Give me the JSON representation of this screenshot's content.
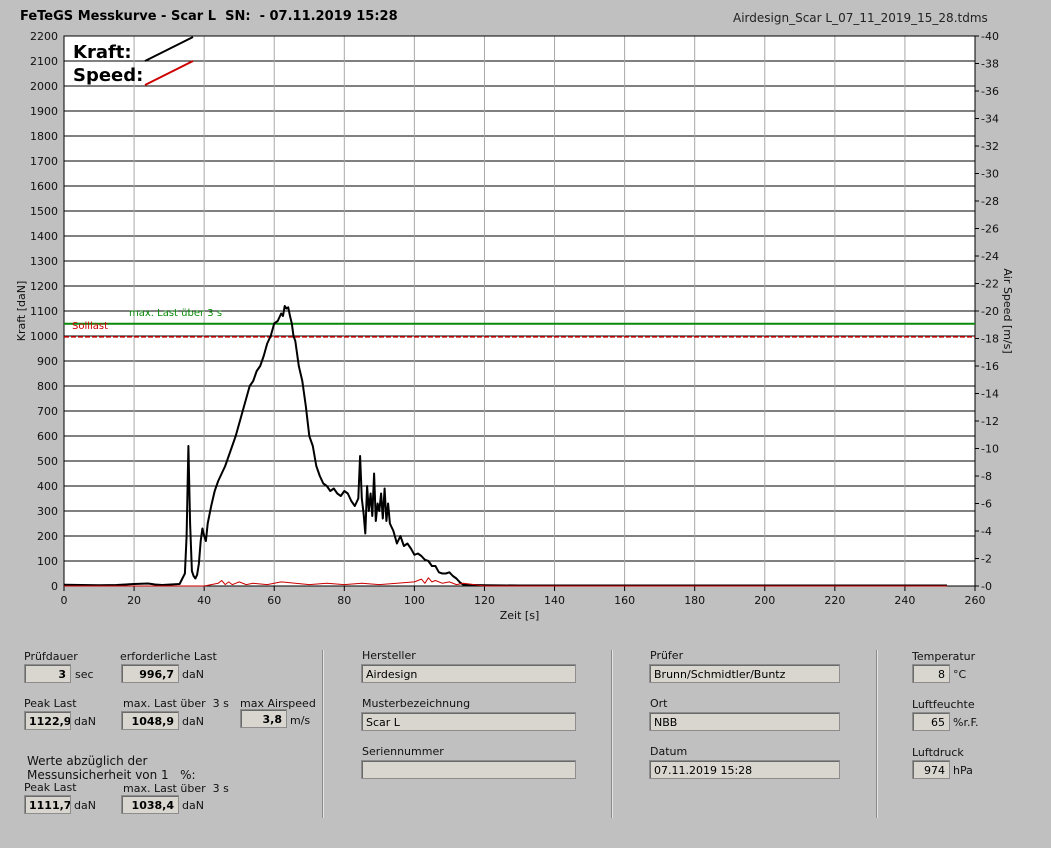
{
  "header": {
    "title": "FeTeGS Messkurve - Scar L  SN:  - 07.11.2019 15:28",
    "filename": "Airdesign_Scar L_07_11_2019_15_28.tdms"
  },
  "chart_data": {
    "type": "line",
    "xlabel": "Zeit [s]",
    "ylabel": "Kraft [daN]",
    "y2label": "Air Speed [m/s]",
    "xlim": [
      0,
      260
    ],
    "ylim": [
      0,
      2200
    ],
    "y2lim": [
      0,
      40
    ],
    "x_ticks": [
      0,
      20,
      40,
      60,
      80,
      100,
      120,
      140,
      160,
      180,
      200,
      220,
      240,
      260
    ],
    "y_ticks": [
      0,
      100,
      200,
      300,
      400,
      500,
      600,
      700,
      800,
      900,
      1000,
      1100,
      1200,
      1300,
      1400,
      1500,
      1600,
      1700,
      1800,
      1900,
      2000,
      2100,
      2200
    ],
    "y2_ticks": [
      0,
      2,
      4,
      6,
      8,
      10,
      12,
      14,
      16,
      18,
      20,
      22,
      24,
      26,
      28,
      30,
      32,
      34,
      36,
      38,
      40
    ],
    "grid": true,
    "legend": {
      "placement": "top-left",
      "items": [
        {
          "label": "Kraft:",
          "color": "#000000"
        },
        {
          "label": "Speed:",
          "color": "#cc0000"
        }
      ]
    },
    "series": [
      {
        "name": "Kraft:",
        "color": "#000000",
        "axis": "left",
        "x": [
          0,
          5,
          10,
          15,
          20,
          24,
          26,
          28,
          33,
          34.5,
          35,
          35.5,
          36,
          36.5,
          37,
          37.5,
          38,
          38.5,
          39,
          39.5,
          40,
          40.5,
          41,
          42,
          43,
          44,
          45,
          46,
          47,
          48,
          49,
          50,
          51,
          52,
          53,
          54,
          55,
          56,
          57,
          58,
          59,
          60,
          61,
          62,
          62.5,
          63,
          63.5,
          64,
          64.5,
          65,
          65.5,
          66,
          67,
          68,
          69,
          70,
          71,
          72,
          73,
          74,
          75,
          76,
          77,
          78,
          79,
          80,
          81,
          82,
          83,
          84,
          84.5,
          85,
          85.5,
          86,
          86.5,
          87,
          87.5,
          88,
          88.5,
          89,
          89.5,
          90,
          90.5,
          91,
          91.5,
          92,
          92.5,
          93,
          94,
          95,
          96,
          97,
          98,
          99,
          100,
          101,
          102,
          103,
          104,
          105,
          106,
          107,
          108,
          109,
          110,
          111,
          112,
          113,
          114,
          120,
          130,
          150,
          180,
          200,
          220,
          240,
          252
        ],
        "values": [
          5,
          4,
          3,
          4,
          8,
          10,
          6,
          4,
          8,
          50,
          200,
          560,
          250,
          60,
          40,
          30,
          45,
          90,
          180,
          230,
          200,
          180,
          250,
          320,
          380,
          420,
          450,
          480,
          520,
          560,
          600,
          650,
          700,
          750,
          800,
          820,
          860,
          880,
          920,
          970,
          1000,
          1050,
          1060,
          1090,
          1080,
          1120,
          1110,
          1115,
          1080,
          1050,
          1000,
          980,
          880,
          820,
          720,
          600,
          560,
          480,
          440,
          410,
          400,
          380,
          390,
          370,
          360,
          380,
          370,
          340,
          320,
          350,
          520,
          350,
          290,
          210,
          400,
          300,
          370,
          280,
          450,
          260,
          330,
          300,
          370,
          270,
          390,
          260,
          330,
          250,
          220,
          170,
          200,
          160,
          170,
          150,
          125,
          130,
          120,
          105,
          100,
          80,
          80,
          55,
          50,
          50,
          55,
          40,
          30,
          15,
          5,
          3,
          2,
          2,
          2,
          2,
          2,
          2,
          2
        ]
      },
      {
        "name": "Speed:",
        "color": "#cc0000",
        "axis": "right",
        "x": [
          0,
          20,
          40,
          44,
          45,
          46,
          47,
          48,
          49,
          50,
          52,
          54,
          58,
          62,
          66,
          70,
          75,
          80,
          85,
          90,
          95,
          100,
          102,
          103,
          104,
          105,
          106,
          108,
          110,
          112,
          114,
          120,
          140,
          160,
          180,
          200,
          220,
          240,
          252
        ],
        "values": [
          0,
          0,
          0,
          0.2,
          0.4,
          0.1,
          0.3,
          0.1,
          0.2,
          0.3,
          0.1,
          0.2,
          0.1,
          0.3,
          0.2,
          0.1,
          0.2,
          0.1,
          0.2,
          0.1,
          0.2,
          0.3,
          0.5,
          0.2,
          0.6,
          0.3,
          0.4,
          0.2,
          0.3,
          0.1,
          0.2,
          0,
          0,
          0,
          0,
          0,
          0,
          0,
          0
        ]
      }
    ],
    "reference_lines": [
      {
        "label": "max. Last über  3 s",
        "value": 1048.9,
        "color": "#0a8a0a"
      },
      {
        "label": "Solllast",
        "value": 996.7,
        "color": "#cc0000"
      }
    ]
  },
  "form": {
    "pruefdauer": {
      "label": "Prüfdauer",
      "value": "3",
      "unit": "sec"
    },
    "erforderliche_last": {
      "label": "erforderliche Last",
      "value": "996,7",
      "unit": "daN"
    },
    "peak_last": {
      "label": "Peak Last",
      "value": "1122,9",
      "unit": "daN"
    },
    "max_last": {
      "label": "max. Last über  3 s",
      "value": "1048,9",
      "unit": "daN"
    },
    "max_airspeed": {
      "label": "max Airspeed",
      "value": "3,8",
      "unit": "m/s"
    },
    "werte_note": "Werte abzüglich der\nMessunsicherheit von 1   %:",
    "peak_last_corr": {
      "label": "Peak Last",
      "value": "1111,7",
      "unit": "daN"
    },
    "max_last_corr": {
      "label": "max. Last über  3 s",
      "value": "1038,4",
      "unit": "daN"
    },
    "hersteller": {
      "label": "Hersteller",
      "value": "Airdesign"
    },
    "muster": {
      "label": "Musterbezeichnung",
      "value": "Scar L"
    },
    "serie": {
      "label": "Seriennummer",
      "value": ""
    },
    "pruefer": {
      "label": "Prüfer",
      "value": "Brunn/Schmidtler/Buntz"
    },
    "ort": {
      "label": "Ort",
      "value": "NBB"
    },
    "datum": {
      "label": "Datum",
      "value": "07.11.2019 15:28"
    },
    "temperatur": {
      "label": "Temperatur",
      "value": "8",
      "unit": "°C"
    },
    "luftfeuchte": {
      "label": "Luftfeuchte",
      "value": "65",
      "unit": "%r.F."
    },
    "luftdruck": {
      "label": "Luftdruck",
      "value": "974",
      "unit": "hPa"
    }
  }
}
